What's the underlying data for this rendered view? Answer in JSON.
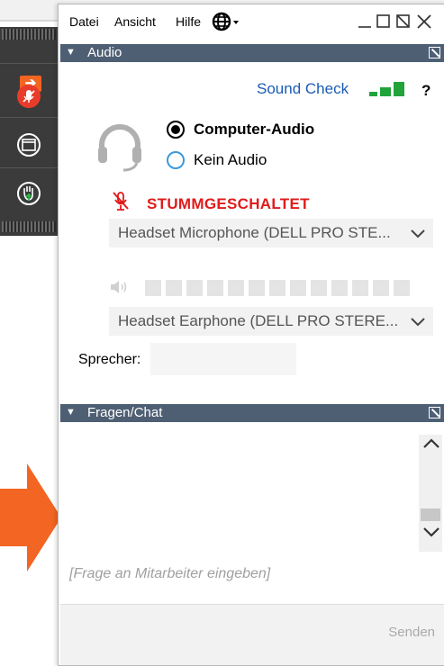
{
  "menubar": {
    "items": [
      "Datei",
      "Ansicht",
      "Hilfe"
    ]
  },
  "audio": {
    "header": "Audio",
    "sound_check": "Sound Check",
    "help": "?",
    "options": [
      {
        "label": "Computer-Audio",
        "selected": true
      },
      {
        "label": "Kein Audio",
        "selected": false
      }
    ],
    "muted_label": "STUMMGESCHALTET",
    "microphone": "Headset Microphone (DELL PRO STE...",
    "speaker_device": "Headset Earphone (DELL PRO STERE...",
    "speaker_label": "Sprecher:"
  },
  "chat": {
    "header": "Fragen/Chat",
    "placeholder": "[Frage an Mitarbeiter eingeben]",
    "send_label": "Senden"
  },
  "colors": {
    "header_bg": "#4e5f73",
    "muted_red": "#e01b1b",
    "link_blue": "#1a5bb5",
    "bar_green": "#22a33a",
    "accent_orange": "#f26522"
  }
}
